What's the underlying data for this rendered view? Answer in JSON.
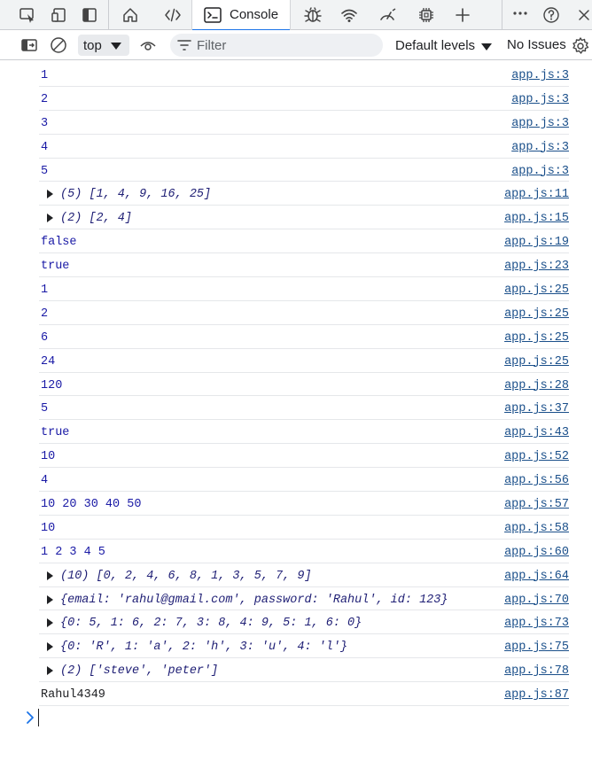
{
  "tabs": {
    "active": "Console",
    "icons": [
      "inspect-icon",
      "device-toolbar-icon",
      "dock-icon",
      "welcome-icon",
      "elements-icon",
      "console-icon",
      "sources-icon",
      "network-icon",
      "performance-icon",
      "memory-icon",
      "add-tab-icon",
      "more-icon",
      "help-icon"
    ]
  },
  "toolbar": {
    "context": "top",
    "filter_placeholder": "Filter",
    "levels": "Default levels",
    "issues": "No Issues"
  },
  "console": {
    "rows": [
      {
        "msg": "1",
        "src": "app.js:3",
        "kind": "num"
      },
      {
        "msg": "2",
        "src": "app.js:3",
        "kind": "num"
      },
      {
        "msg": "3",
        "src": "app.js:3",
        "kind": "num"
      },
      {
        "msg": "4",
        "src": "app.js:3",
        "kind": "num"
      },
      {
        "msg": "5",
        "src": "app.js:3",
        "kind": "num"
      },
      {
        "msg": "(5) [1, 4, 9, 16, 25]",
        "src": "app.js:11",
        "kind": "expand"
      },
      {
        "msg": "(2) [2, 4]",
        "src": "app.js:15",
        "kind": "expand"
      },
      {
        "msg": "false",
        "src": "app.js:19",
        "kind": "num"
      },
      {
        "msg": "true",
        "src": "app.js:23",
        "kind": "num"
      },
      {
        "msg": "1",
        "src": "app.js:25",
        "kind": "num"
      },
      {
        "msg": "2",
        "src": "app.js:25",
        "kind": "num"
      },
      {
        "msg": "6",
        "src": "app.js:25",
        "kind": "num"
      },
      {
        "msg": "24",
        "src": "app.js:25",
        "kind": "num"
      },
      {
        "msg": "120",
        "src": "app.js:28",
        "kind": "num"
      },
      {
        "msg": "5",
        "src": "app.js:37",
        "kind": "num"
      },
      {
        "msg": "true",
        "src": "app.js:43",
        "kind": "num"
      },
      {
        "msg": "10",
        "src": "app.js:52",
        "kind": "num"
      },
      {
        "msg": "4",
        "src": "app.js:56",
        "kind": "num"
      },
      {
        "msg": "10 20 30 40 50",
        "src": "app.js:57",
        "kind": "num"
      },
      {
        "msg": "10",
        "src": "app.js:58",
        "kind": "num"
      },
      {
        "msg": "1 2 3 4 5",
        "src": "app.js:60",
        "kind": "num"
      },
      {
        "msg": "(10) [0, 2, 4, 6, 8, 1, 3, 5, 7, 9]",
        "src": "app.js:64",
        "kind": "expand"
      },
      {
        "msg": "{email: 'rahul@gmail.com', password: 'Rahul', id: 123}",
        "src": "app.js:70",
        "kind": "expand"
      },
      {
        "msg": "{0: 5, 1: 6, 2: 7, 3: 8, 4: 9, 5: 1, 6: 0}",
        "src": "app.js:73",
        "kind": "expand"
      },
      {
        "msg": "{0: 'R', 1: 'a', 2: 'h', 3: 'u', 4: 'l'}",
        "src": "app.js:75",
        "kind": "expand"
      },
      {
        "msg": "(2) ['steve', 'peter']",
        "src": "app.js:78",
        "kind": "expand"
      },
      {
        "msg": "Rahul4349",
        "src": "app.js:87",
        "kind": "str"
      }
    ]
  },
  "colors": {
    "accent": "#1a73e8",
    "link": "#1a4f8a",
    "value": "#1a1aa6"
  }
}
